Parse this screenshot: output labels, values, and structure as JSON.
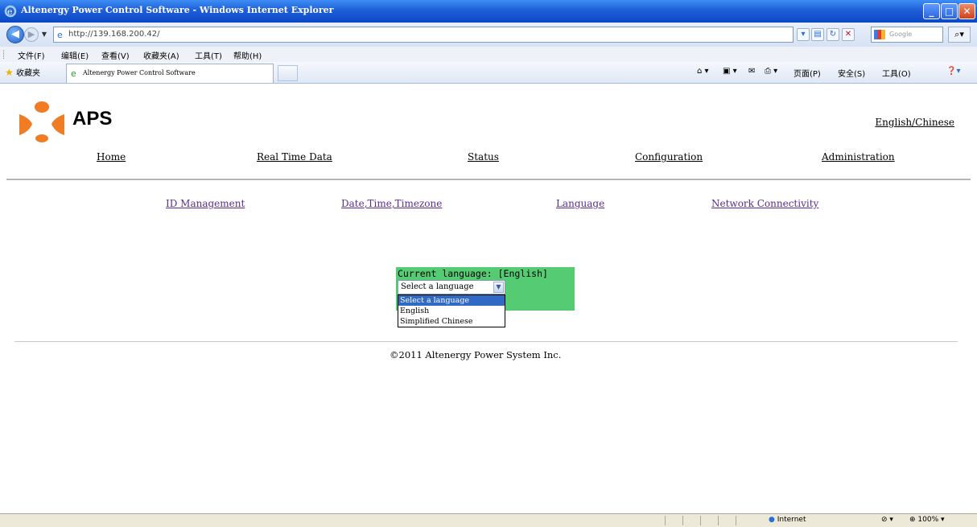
{
  "window": {
    "title": "Altenergy Power Control Software - Windows Internet Explorer",
    "minimize": "_",
    "maximize": "□",
    "close": "✕"
  },
  "address_bar": {
    "url": "http://139.168.200.42/",
    "search_placeholder": "Google"
  },
  "menu": {
    "items": [
      "文件(F)",
      "编辑(E)",
      "查看(V)",
      "收藏夹(A)",
      "工具(T)",
      "帮助(H)"
    ]
  },
  "tabs": {
    "favorites_label": "收藏夹",
    "active_tab": "Altenergy Power Control Software"
  },
  "command_bar": {
    "page": "页面(P)",
    "safety": "安全(S)",
    "tools": "工具(O)"
  },
  "page": {
    "brand": "APS",
    "language_toggle": "English/Chinese",
    "top_nav": [
      "Home",
      "Real Time Data",
      "Status",
      "Configuration",
      "Administration"
    ],
    "sub_nav": [
      "ID Management",
      "Date,Time,Timezone",
      "Language",
      "Network Connectivity"
    ],
    "language_panel": {
      "current_language": "Current language: [English]",
      "select_value": "Select a language",
      "options": [
        "Select a language",
        "English",
        "Simplified Chinese"
      ]
    },
    "copyright": "©2011 Altenergy Power System Inc."
  },
  "status_bar": {
    "zone": "Internet",
    "zoom": "100%"
  },
  "colors": {
    "titlebar": "#0a47c6",
    "language_panel_bg": "#55cc74",
    "option_highlight": "#316ac5",
    "link_visited": "#5b2d8e",
    "logo_orange": "#f07d23"
  }
}
